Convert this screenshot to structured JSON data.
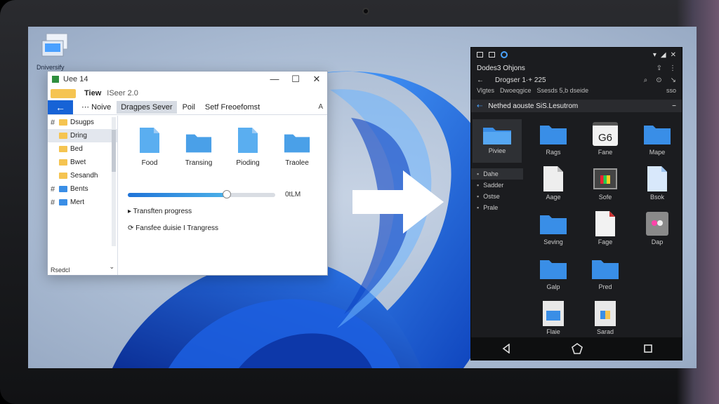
{
  "desktop": {
    "icon_label": "Dniversify"
  },
  "explorer": {
    "title": "Uee 14",
    "view_label": "Tiew",
    "view_sub": "ISeer 2.0",
    "toolbar": {
      "home": "Noive",
      "active_tab": "Dragpes Sever",
      "item2": "Poil",
      "item3": "Setf Freoefomst",
      "right_hint": "A"
    },
    "controls": {
      "minimize": "—",
      "maximize": "☐",
      "close": "✕"
    },
    "sidebar": {
      "items": [
        {
          "label": "Dsugps",
          "pinned": true,
          "color": "yellow"
        },
        {
          "label": "Dring",
          "pinned": false,
          "color": "yellow",
          "selected": true
        },
        {
          "label": "Bed",
          "pinned": false,
          "color": "yellow"
        },
        {
          "label": "Bwet",
          "pinned": false,
          "color": "yellow"
        },
        {
          "label": "Sesandh",
          "pinned": false,
          "color": "yellow"
        },
        {
          "label": "Bents",
          "pinned": true,
          "color": "blue"
        },
        {
          "label": "Mert",
          "pinned": true,
          "color": "blue"
        }
      ],
      "footer": "Rsedcl",
      "footer_right": "⌄"
    },
    "files": [
      {
        "name": "Food",
        "type": "doc"
      },
      {
        "name": "Transing",
        "type": "folder"
      },
      {
        "name": "Pioding",
        "type": "doc"
      },
      {
        "name": "Traolee",
        "type": "folder"
      }
    ],
    "transfer": {
      "progress": 0.67,
      "size_label": "0tLM",
      "status1": "Transften progress",
      "status2": "Fansfee duisie I Trangress"
    }
  },
  "phone": {
    "status_icons": [
      "image-icon",
      "image-icon",
      "circle-icon"
    ],
    "status_right": [
      "wifi-icon",
      "signal-icon",
      "close-icon"
    ],
    "title": "Dodes3 Ohjons",
    "title_actions": [
      "share-icon",
      "more-icon"
    ],
    "header": "Drogser 1·+ 225",
    "sub_left": "Vlgtes",
    "sub_mid": "Dwoeqgice",
    "sub_mid2": "Ssesds 5,b dseide",
    "sub_right": "sso",
    "path": "Nethed aouste SiS.Lesutrom",
    "side": {
      "tile_label": "Piviee",
      "items": [
        {
          "label": "Dahe",
          "highlight": true
        },
        {
          "label": "Sadder",
          "highlight": false
        },
        {
          "label": "Ostse",
          "highlight": false
        },
        {
          "label": "Prale",
          "highlight": false
        }
      ]
    },
    "grid": [
      {
        "name": "Rags",
        "type": "folder"
      },
      {
        "name": "Fane",
        "type": "calendar",
        "badge": "G6"
      },
      {
        "name": "Mape",
        "type": "folder"
      },
      {
        "name": "Aage",
        "type": "doc"
      },
      {
        "name": "Sofe",
        "type": "image"
      },
      {
        "name": "Bsok",
        "type": "doc-blue"
      },
      {
        "name": "Seving",
        "type": "folder"
      },
      {
        "name": "Fage",
        "type": "doc-color"
      },
      {
        "name": "Dap",
        "type": "image-gray"
      },
      {
        "name": "Galp",
        "type": "folder"
      },
      {
        "name": "Pred",
        "type": "folder"
      },
      {
        "name": "",
        "type": "none"
      },
      {
        "name": "Flaie",
        "type": "doc-art"
      },
      {
        "name": "Sarad",
        "type": "doc-art2"
      },
      {
        "name": "",
        "type": "none"
      }
    ],
    "nav": [
      "back-icon",
      "home-icon",
      "recents-icon"
    ]
  },
  "colors": {
    "accent": "#1763d6",
    "folder_blue": "#3a8ee6",
    "folder_yellow": "#f5c451",
    "phone_bg": "#1b1c1f"
  }
}
